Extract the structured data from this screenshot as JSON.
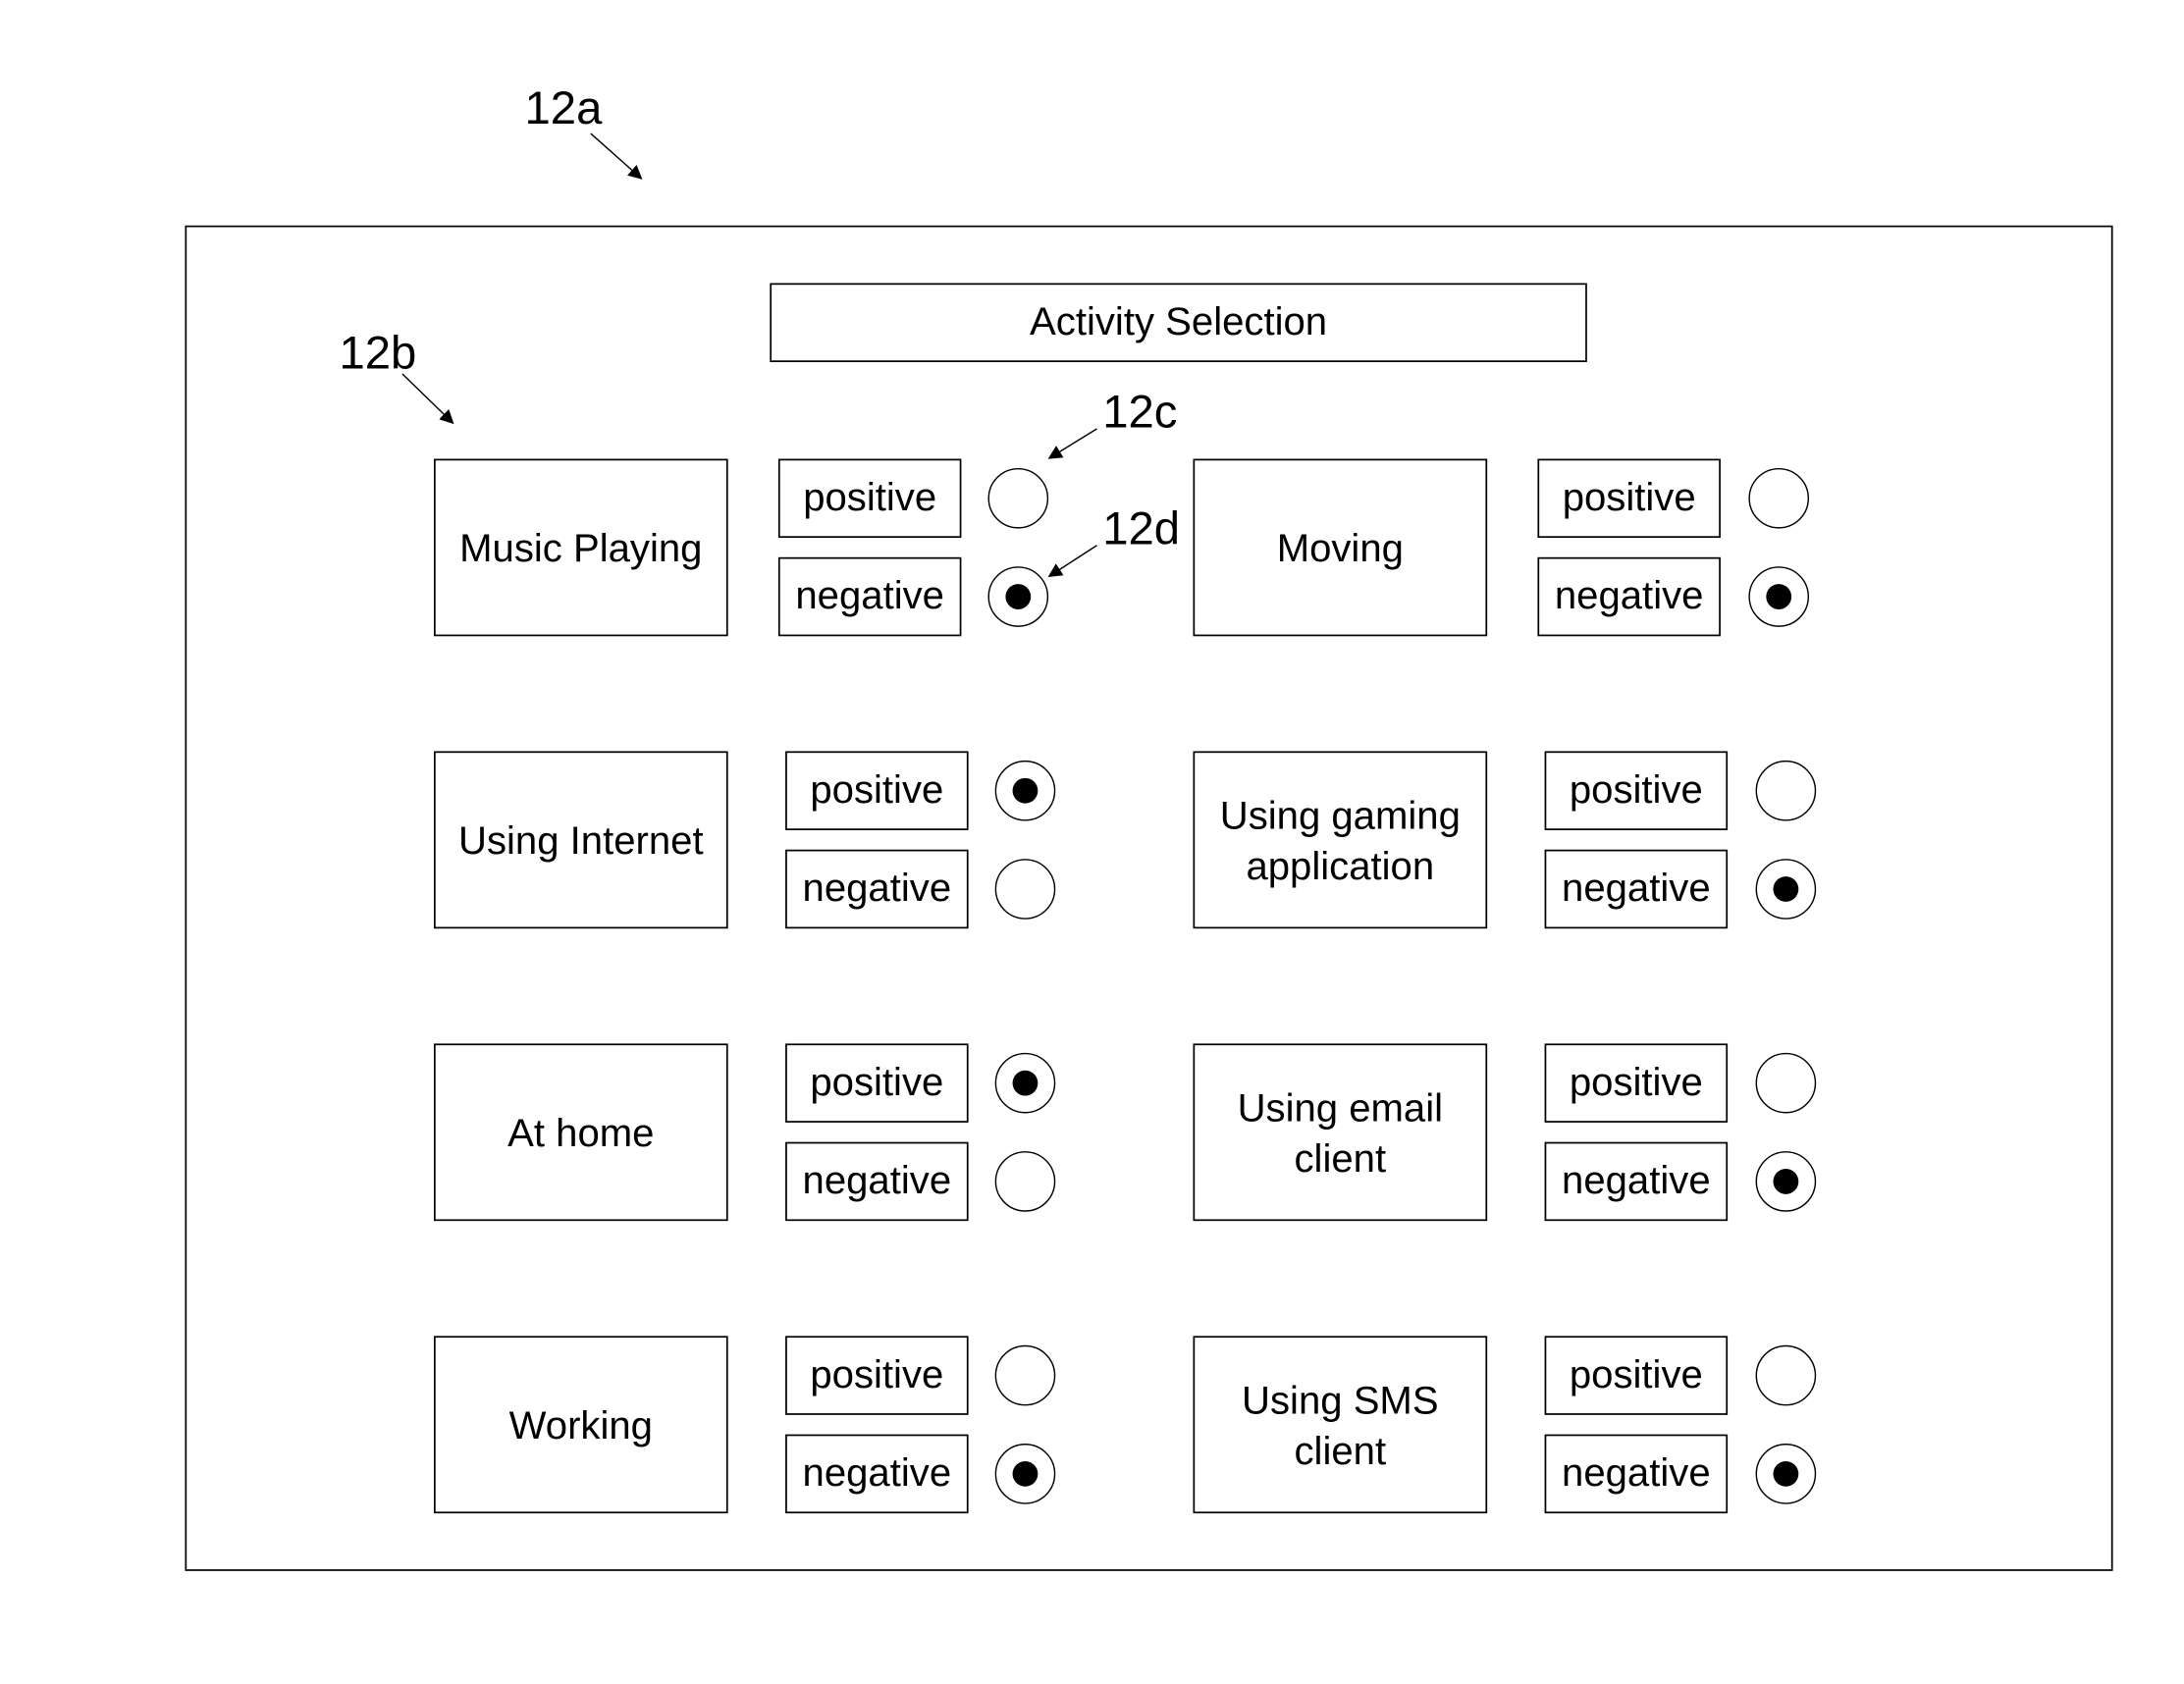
{
  "figure": {
    "reference_labels": {
      "panel": "12a",
      "activity": "12b",
      "positive_radio": "12c",
      "negative_radio": "12d"
    },
    "title": "Activity Selection",
    "option_labels": {
      "positive": "positive",
      "negative": "negative"
    },
    "activities": [
      {
        "lines": [
          "Music Playing"
        ],
        "selected": "negative"
      },
      {
        "lines": [
          "Moving"
        ],
        "selected": "negative"
      },
      {
        "lines": [
          "Using Internet"
        ],
        "selected": "positive"
      },
      {
        "lines": [
          "Using gaming",
          "application"
        ],
        "selected": "negative"
      },
      {
        "lines": [
          "At home"
        ],
        "selected": "positive"
      },
      {
        "lines": [
          "Using email",
          "client"
        ],
        "selected": "negative"
      },
      {
        "lines": [
          "Working"
        ],
        "selected": "negative"
      },
      {
        "lines": [
          "Using SMS",
          "client"
        ],
        "selected": "negative"
      }
    ]
  }
}
